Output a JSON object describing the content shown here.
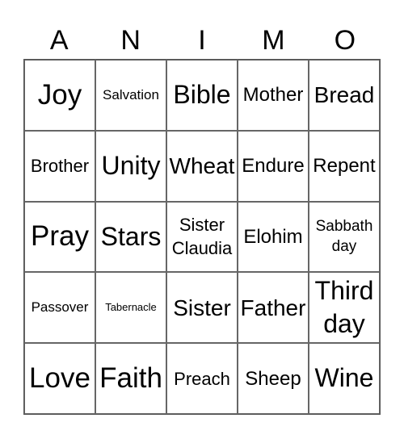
{
  "title_letters": [
    "A",
    "N",
    "I",
    "M",
    "O"
  ],
  "cells": [
    [
      "Joy",
      "Salvation",
      "Bible",
      "Mother",
      "Bread"
    ],
    [
      "Brother",
      "Unity",
      "Wheat",
      "Endure",
      "Repent"
    ],
    [
      "Pray",
      "Stars",
      "Sister\nClaudia",
      "Elohim",
      "Sabbath\nday"
    ],
    [
      "Passover",
      "Tabernacle",
      "Sister",
      "Father",
      "Third\nday"
    ],
    [
      "Love",
      "Faith",
      "Preach",
      "Sheep",
      "Wine"
    ]
  ]
}
